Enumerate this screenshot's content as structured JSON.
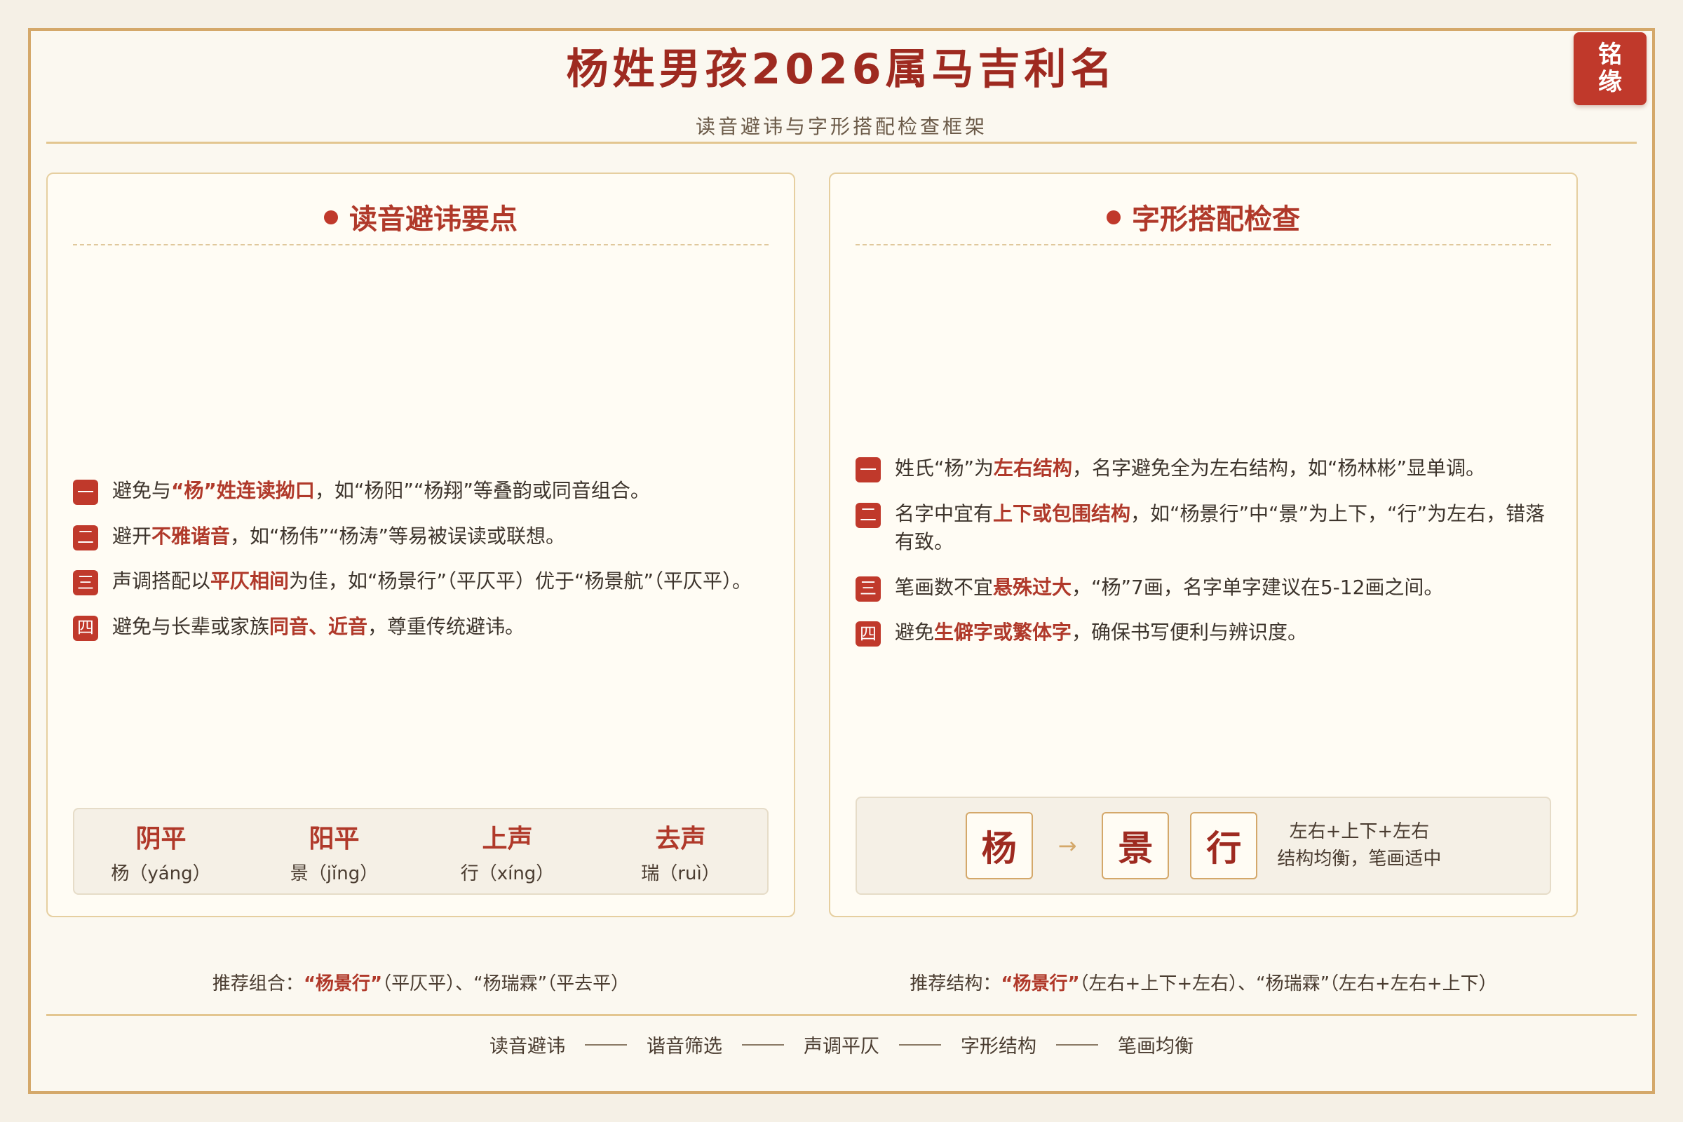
{
  "header": {
    "title": "杨姓男孩2026属马吉利名",
    "subtitle": "读音避讳与字形搭配检查框架",
    "seal_line1": "铭",
    "seal_line2": "缘"
  },
  "left_panel": {
    "title": "读音避讳要点",
    "items": [
      {
        "num": "一",
        "pre": "避免与",
        "hl": "“杨”姓连读拗口",
        "post": "，如“杨阳”“杨翔”等叠韵或同音组合。"
      },
      {
        "num": "二",
        "pre": "避开",
        "hl": "不雅谐音",
        "post": "，如“杨伟”“杨涛”等易被误读或联想。"
      },
      {
        "num": "三",
        "pre": "声调搭配以",
        "hl": "平仄相间",
        "post": "为佳，如“杨景行”（平仄平）优于“杨景航”（平仄平）。"
      },
      {
        "num": "四",
        "pre": "避免与长辈或家族",
        "hl": "同音、近音",
        "post": "，尊重传统避讳。"
      }
    ],
    "tones": [
      {
        "name": "阴平",
        "example": "杨（yáng）"
      },
      {
        "name": "阳平",
        "example": "景（jǐng）"
      },
      {
        "name": "上声",
        "example": "行（xíng）"
      },
      {
        "name": "去声",
        "example": "瑞（ruì）"
      }
    ],
    "recommend_label": "推荐组合：",
    "recommend_hl": "“杨景行”",
    "recommend_rest": "（平仄平）、“杨瑞霖”（平去平）"
  },
  "right_panel": {
    "title": "字形搭配检查",
    "items": [
      {
        "num": "一",
        "pre": "姓氏“杨”为",
        "hl": "左右结构",
        "post": "，名字避免全为左右结构，如“杨林彬”显单调。"
      },
      {
        "num": "二",
        "pre": "名字中宜有",
        "hl": "上下或包围结构",
        "post": "，如“杨景行”中“景”为上下，“行”为左右，错落有致。"
      },
      {
        "num": "三",
        "pre": "笔画数不宜",
        "hl": "悬殊过大",
        "post": "，“杨”7画，名字单字建议在5-12画之间。"
      },
      {
        "num": "四",
        "pre": "避免",
        "hl": "生僻字或繁体字",
        "post": "，确保书写便利与辨识度。"
      }
    ],
    "chars": [
      "杨",
      "景",
      "行"
    ],
    "arrow": "→",
    "note_line1": "左右+上下+左右",
    "note_line2": "结构均衡，笔画适中",
    "recommend_label": "推荐结构：",
    "recommend_hl": "“杨景行”",
    "recommend_rest": "（左右+上下+左右）、“杨瑞霖”（左右+左右+上下）"
  },
  "footer": [
    "读音避讳",
    "谐音筛选",
    "声调平仄",
    "字形结构",
    "笔画均衡"
  ],
  "colors": {
    "accent": "#b0392a",
    "seal": "#c0392b",
    "border": "#d4a86a",
    "background": "#f5f0e6"
  }
}
